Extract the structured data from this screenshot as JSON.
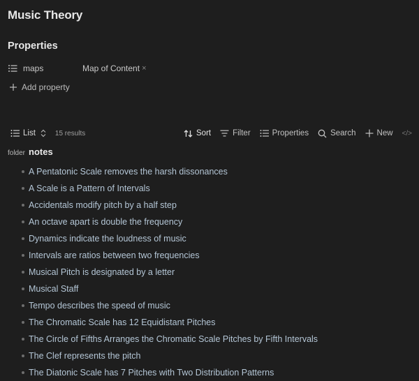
{
  "title": "Music Theory",
  "properties": {
    "heading": "Properties",
    "items": [
      {
        "key": "maps",
        "icon": "list-icon",
        "value": "Map of Content",
        "remove_glyph": "×"
      }
    ],
    "add_label": "Add property"
  },
  "toolbar": {
    "view_label": "List",
    "results": "15 results",
    "sort_label": "Sort",
    "filter_label": "Filter",
    "properties_label": "Properties",
    "search_label": "Search",
    "new_label": "New",
    "code_glyph": "</>"
  },
  "group": {
    "prefix": "folder",
    "name": "notes"
  },
  "notes": [
    "A Pentatonic Scale removes the harsh dissonances",
    "A Scale is a Pattern of Intervals",
    "Accidentals modify pitch by a half step",
    "An octave apart is double the frequency",
    "Dynamics indicate the loudness of music",
    "Intervals are ratios between two frequencies",
    "Musical Pitch is designated by a letter",
    "Musical Staff",
    "Tempo describes the speed of music",
    "The Chromatic Scale has 12 Equidistant Pitches",
    "The Circle of Fifths Arranges the Chromatic Scale Pitches by Fifth Intervals",
    "The Clef represents the pitch",
    "The Diatonic Scale has 7 Pitches with Two Distribution Patterns"
  ],
  "colors": {
    "background": "#1e1e1e",
    "text": "#dadada",
    "link": "#b4c6d6"
  }
}
